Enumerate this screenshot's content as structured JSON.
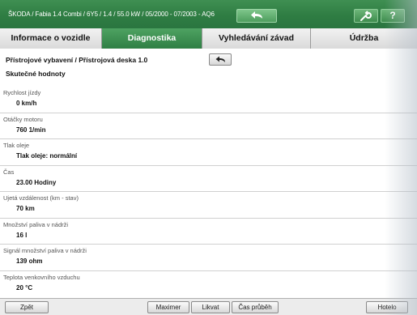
{
  "header": {
    "title": "ŠKODA / Fabia 1.4 Combi / 6Y5 / 1.4 / 55.0 kW / 05/2000 - 07/2003 - AQ6",
    "back_icon": "back-arrow-icon",
    "wrench_icon": "wrench-icon",
    "help_label": "?"
  },
  "tabs": [
    {
      "label": "Informace o vozidle",
      "active": false
    },
    {
      "label": "Diagnostika",
      "active": true
    },
    {
      "label": "Vyhledávání závad",
      "active": false
    },
    {
      "label": "Údržba",
      "active": false
    }
  ],
  "main": {
    "breadcrumb": "Přístrojové vybavení / Přístrojová deska 1.0",
    "subtitle": "Skutečné hodnoty",
    "return_icon": "return-arrow-icon",
    "items": [
      {
        "label": "Rychlost jízdy",
        "value": "0 km/h"
      },
      {
        "label": "Otáčky motoru",
        "value": "760 1/min"
      },
      {
        "label": "Tlak oleje",
        "value": "Tlak oleje: normální"
      },
      {
        "label": "Čas",
        "value": "23.00 Hodiny"
      },
      {
        "label": "Ujetá vzdálenost (km - stav)",
        "value": "70 km"
      },
      {
        "label": "Množství paliva v nádrži",
        "value": "16 l"
      },
      {
        "label": "Signál množství paliva v nádrži",
        "value": "139 ohm"
      },
      {
        "label": "Teplota venkovního vzduchu",
        "value": "20 °C"
      }
    ]
  },
  "footer": {
    "back": "Zpět",
    "maximize": "Maximer",
    "print": "Likvat",
    "time_lapse": "Čas průběh",
    "next": "Hotelo"
  },
  "colors": {
    "brand_green": "#2f7d43",
    "tab_active": "#3d9152"
  }
}
